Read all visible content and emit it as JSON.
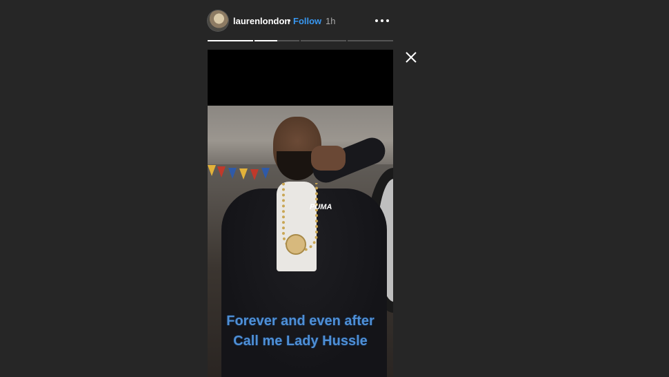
{
  "story": {
    "username": "laurenlondon",
    "separator": "•",
    "follow_label": "Follow",
    "time_ago": "1h",
    "segments": [
      {
        "progress": 1.0
      },
      {
        "progress": 0.5
      },
      {
        "progress": 0
      },
      {
        "progress": 0
      }
    ],
    "image": {
      "brand_text": "PUMA",
      "caption_line1": "Forever and even after",
      "caption_line2": "Call me Lady Hussle",
      "caption_color": "#4e8fd6"
    }
  },
  "icons": {
    "more": "more-options-icon",
    "close": "close-icon"
  },
  "colors": {
    "background": "#262626",
    "link": "#3897f0"
  }
}
